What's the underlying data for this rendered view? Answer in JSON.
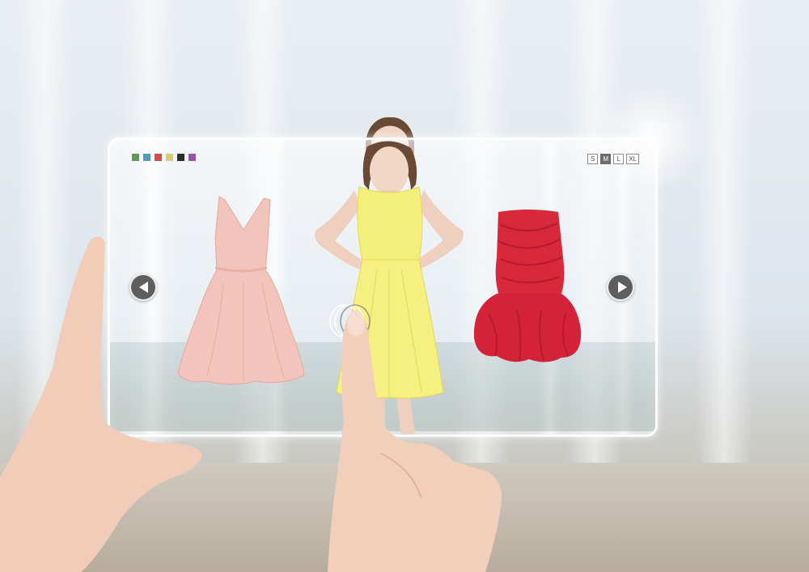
{
  "image_description_free": true,
  "colors": {
    "swatches": [
      "#5c9b57",
      "#4c9bc0",
      "#d74b4b",
      "#d9cd6c",
      "#2b2b2b",
      "#9a4fb3"
    ],
    "pink_dress": "#f3c4bb",
    "yellow_dress": "#f3ef7a",
    "red_dress": "#d7283c",
    "nav_button": "#5e5e5e"
  },
  "sizes": [
    {
      "label": "S",
      "active": false
    },
    {
      "label": "M",
      "active": true
    },
    {
      "label": "L",
      "active": false
    },
    {
      "label": "XL",
      "active": false
    }
  ],
  "icons": {
    "prev": "chevron-left-icon",
    "next": "chevron-right-icon"
  }
}
